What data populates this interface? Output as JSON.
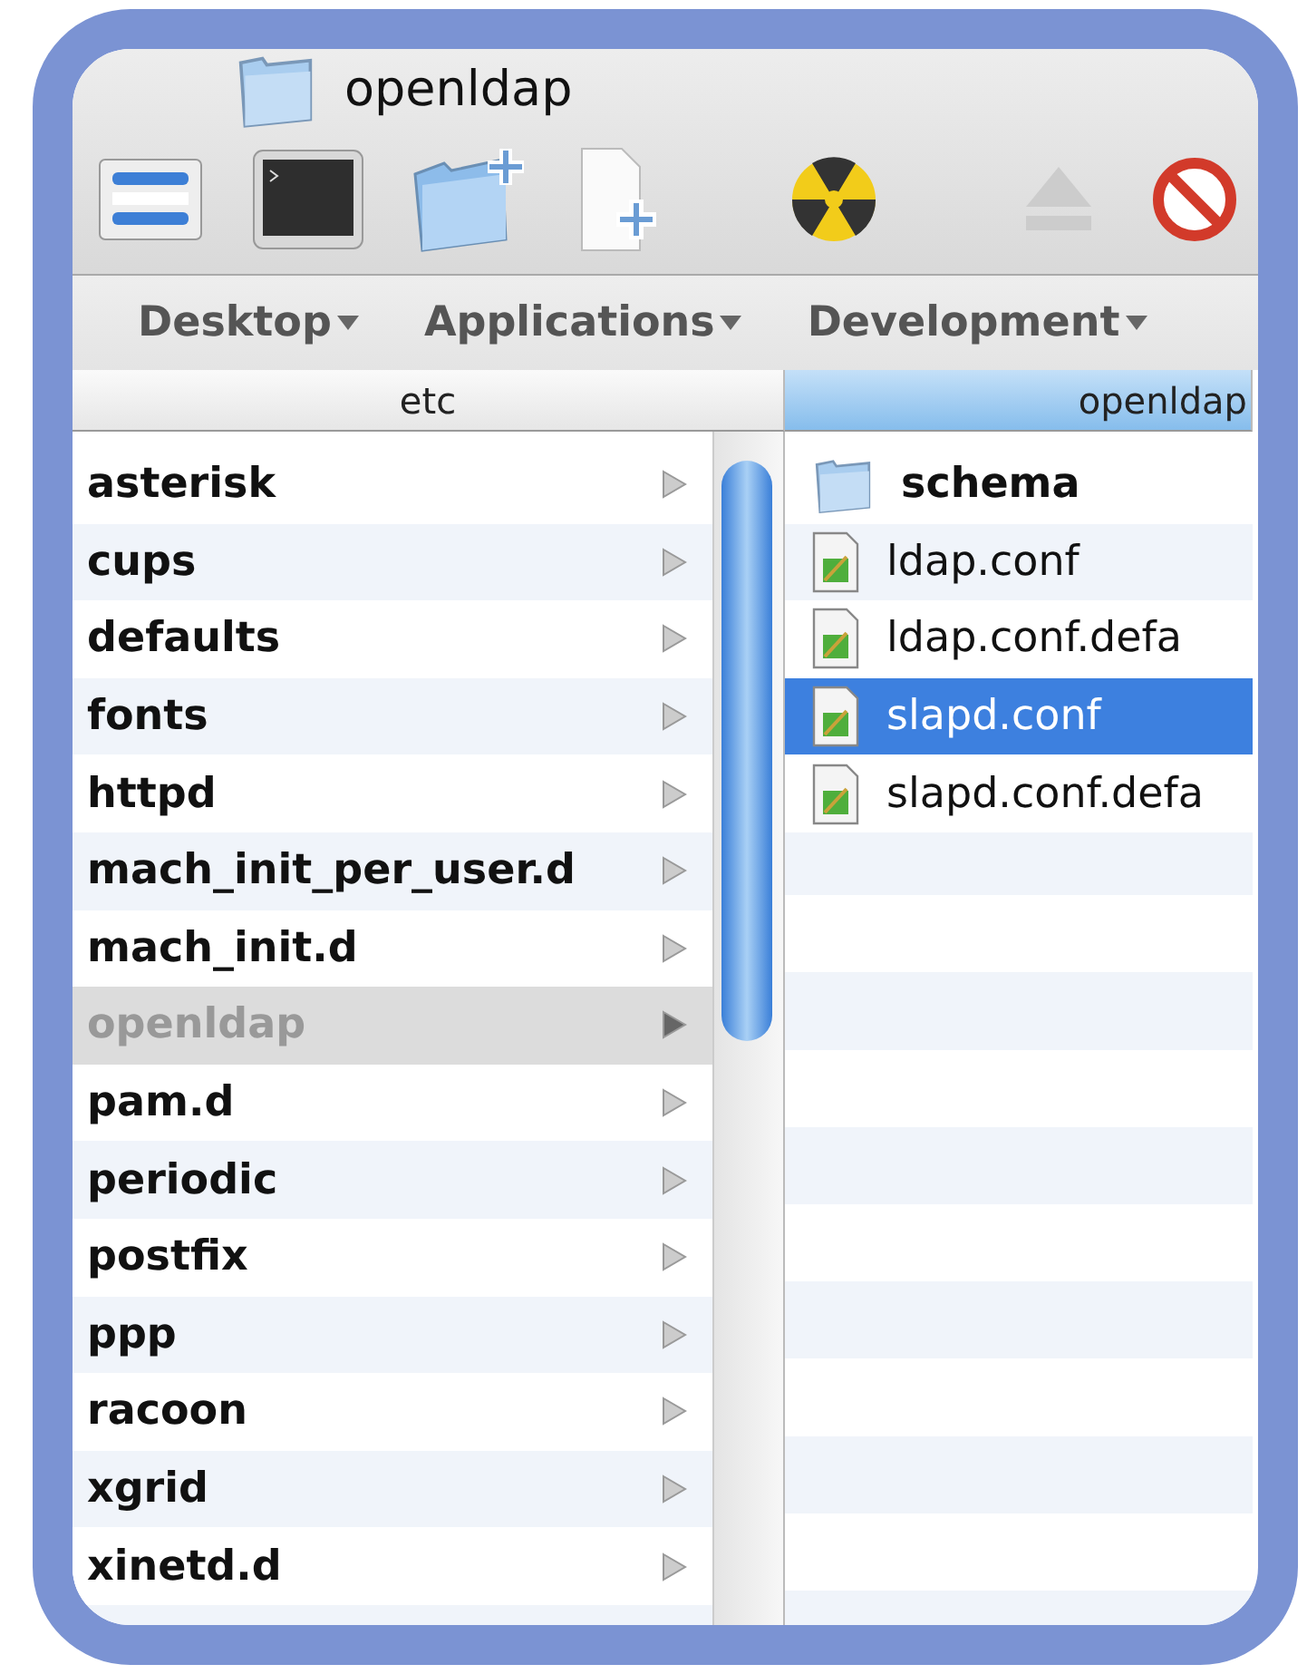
{
  "window": {
    "title": "openldap"
  },
  "toolbar": [
    {
      "kind": "view"
    },
    {
      "kind": "terminal"
    },
    {
      "kind": "new-folder"
    },
    {
      "kind": "new-file"
    },
    {
      "kind": "burn"
    },
    {
      "kind": "eject"
    },
    {
      "kind": "stop"
    }
  ],
  "path_bar": [
    "Desktop",
    "Applications",
    "Development"
  ],
  "columns": [
    {
      "header": "etc",
      "selected": false,
      "items": [
        {
          "name": "asterisk",
          "kind": "folder",
          "selected": false
        },
        {
          "name": "cups",
          "kind": "folder",
          "selected": false
        },
        {
          "name": "defaults",
          "kind": "folder",
          "selected": false
        },
        {
          "name": "fonts",
          "kind": "folder",
          "selected": false
        },
        {
          "name": "httpd",
          "kind": "folder",
          "selected": false
        },
        {
          "name": "mach_init_per_user.d",
          "kind": "folder",
          "selected": false
        },
        {
          "name": "mach_init.d",
          "kind": "folder",
          "selected": false
        },
        {
          "name": "openldap",
          "kind": "folder",
          "selected": true
        },
        {
          "name": "pam.d",
          "kind": "folder",
          "selected": false
        },
        {
          "name": "periodic",
          "kind": "folder",
          "selected": false
        },
        {
          "name": "postfix",
          "kind": "folder",
          "selected": false
        },
        {
          "name": "ppp",
          "kind": "folder",
          "selected": false
        },
        {
          "name": "racoon",
          "kind": "folder",
          "selected": false
        },
        {
          "name": "xgrid",
          "kind": "folder",
          "selected": false
        },
        {
          "name": "xinetd.d",
          "kind": "folder",
          "selected": false
        }
      ]
    },
    {
      "header": "openldap",
      "selected": true,
      "items": [
        {
          "name": "schema",
          "kind": "folder",
          "selected": false
        },
        {
          "name": "ldap.conf",
          "kind": "file",
          "selected": false
        },
        {
          "name": "ldap.conf.defa",
          "kind": "file",
          "selected": false
        },
        {
          "name": "slapd.conf",
          "kind": "file",
          "selected": true
        },
        {
          "name": "slapd.conf.defa",
          "kind": "file",
          "selected": false
        }
      ]
    }
  ]
}
